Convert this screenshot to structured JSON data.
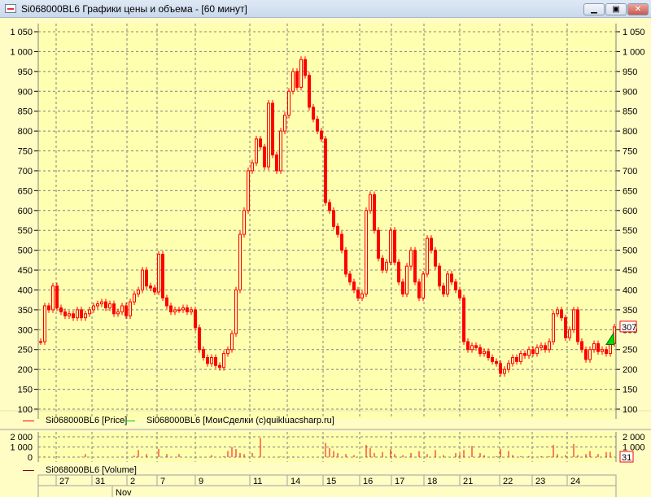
{
  "window": {
    "title": "Si068000BL6 Графики цены и объема - [60 минут]",
    "minimize": "▁",
    "restore": "▣",
    "close": "✕"
  },
  "colors": {
    "price": "#ff0000",
    "deals": "#00cc00",
    "grid": "#808080",
    "plot_bg": "#ffffb0"
  },
  "legend": {
    "price": "Si068000BL6 [Price]",
    "deals": "Si068000BL6 [МоиСделки (c)quikluacsharp.ru]",
    "volume": "Si068000BL6 [Volume]"
  },
  "price_axis": {
    "ticks": [
      "1 050",
      "1 000",
      "950",
      "900",
      "850",
      "800",
      "750",
      "700",
      "650",
      "600",
      "550",
      "500",
      "450",
      "400",
      "350",
      "300",
      "250",
      "200",
      "150",
      "100"
    ],
    "min": 100,
    "max": 1050,
    "last_price": "307"
  },
  "volume_axis": {
    "ticks": [
      "2 000",
      "1 000",
      "0"
    ],
    "max": 2000,
    "last_volume": "31"
  },
  "date_axis": {
    "days": [
      "27",
      "31",
      "2",
      "7",
      "9",
      "11",
      "14",
      "15",
      "16",
      "17",
      "18",
      "21",
      "22",
      "23",
      "24"
    ],
    "month": "Nov"
  },
  "chart_data": {
    "type": "candlestick",
    "closes": [
      270,
      360,
      350,
      410,
      355,
      345,
      335,
      340,
      330,
      350,
      330,
      340,
      350,
      360,
      365,
      370,
      355,
      365,
      340,
      345,
      360,
      335,
      370,
      390,
      400,
      450,
      410,
      405,
      395,
      490,
      380,
      360,
      345,
      350,
      350,
      355,
      345,
      350,
      305,
      250,
      230,
      215,
      230,
      210,
      205,
      240,
      250,
      290,
      400,
      540,
      600,
      700,
      720,
      780,
      760,
      710,
      870,
      740,
      700,
      800,
      840,
      900,
      950,
      910,
      980,
      940,
      860,
      830,
      800,
      780,
      620,
      600,
      560,
      540,
      500,
      440,
      420,
      400,
      380,
      390,
      600,
      640,
      550,
      480,
      450,
      470,
      550,
      470,
      420,
      390,
      460,
      500,
      420,
      380,
      440,
      530,
      500,
      460,
      410,
      390,
      440,
      420,
      400,
      380,
      270,
      250,
      260,
      255,
      240,
      245,
      230,
      220,
      215,
      190,
      200,
      215,
      230,
      220,
      240,
      235,
      250,
      240,
      255,
      260,
      250,
      270,
      340,
      350,
      330,
      280,
      300,
      350,
      270,
      250,
      225,
      250,
      265,
      245,
      250,
      240,
      265,
      307
    ],
    "volumes": [
      0,
      50,
      0,
      0,
      60,
      0,
      20,
      0,
      0,
      0,
      40,
      300,
      0,
      0,
      10,
      0,
      0,
      0,
      0,
      0,
      40,
      0,
      0,
      150,
      700,
      0,
      300,
      0,
      0,
      800,
      0,
      300,
      0,
      0,
      300,
      0,
      0,
      0,
      0,
      0,
      0,
      0,
      200,
      0,
      0,
      100,
      600,
      1000,
      800,
      400,
      300,
      0,
      400,
      0,
      1900,
      0,
      0,
      0,
      0,
      50,
      0,
      0,
      50,
      0,
      0,
      0,
      0,
      0,
      0,
      0,
      1400,
      900,
      600,
      400,
      0,
      300,
      0,
      200,
      0,
      0,
      1200,
      900,
      400,
      0,
      500,
      0,
      800,
      300,
      0,
      200,
      0,
      400,
      0,
      600,
      0,
      300,
      0,
      700,
      0,
      200,
      0,
      0,
      400,
      300,
      700,
      0,
      1100,
      0,
      400,
      200,
      0,
      0,
      100,
      800,
      0,
      600,
      200,
      0,
      100,
      0,
      100,
      0,
      0,
      100,
      0,
      100,
      1200,
      300,
      0,
      200,
      0,
      1300,
      200,
      0,
      300,
      600,
      0,
      300,
      0,
      500,
      500,
      31
    ],
    "my_deal": {
      "type": "buy",
      "price": 275
    }
  }
}
